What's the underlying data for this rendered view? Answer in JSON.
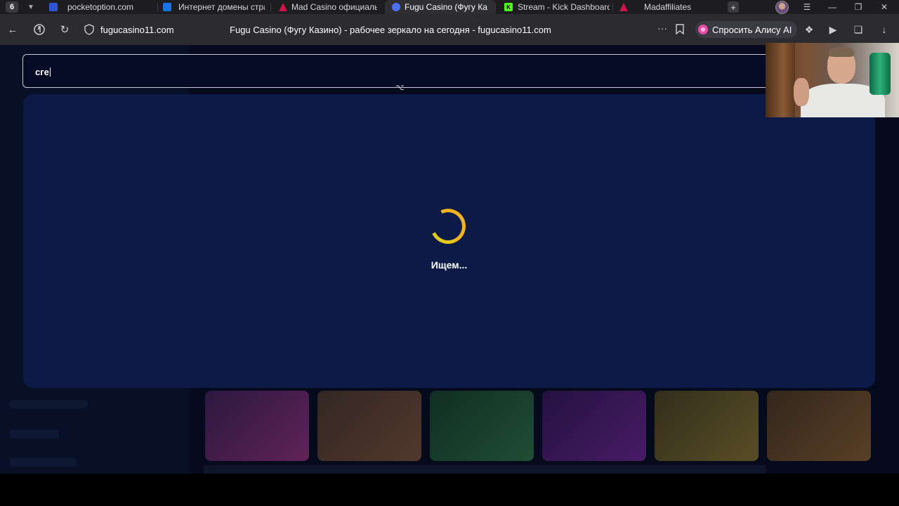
{
  "browser": {
    "tab_count": "6",
    "tabs": [
      {
        "title": "pocketoption.com",
        "favicon_color": "#2f55d4",
        "active": false
      },
      {
        "title": "Интернет домены стран",
        "favicon_color": "#1a73e8",
        "active": false
      },
      {
        "title": "Mad Casino официальны",
        "favicon_color": "#d0134a",
        "active": false
      },
      {
        "title": "Fugu Casino (Фугу Ка",
        "favicon_color": "#4a72ff",
        "active": true
      },
      {
        "title": "Stream - Kick Dashboard",
        "favicon_color": "#53fc18",
        "active": false
      },
      {
        "title": "Madaffiliates",
        "favicon_color": "#d0134a",
        "active": false
      }
    ],
    "tab_close_glyph": "✕",
    "new_tab_glyph": "+",
    "address": {
      "domain": "fugucasino11.com",
      "page_title": "Fugu Casino (Фугу Казино) - рабочее зеркало на сегодня - fugucasino11.com"
    },
    "alice_button_label": "Спросить Алису AI"
  },
  "page": {
    "search": {
      "value": "сге"
    },
    "loading": {
      "text": "Ищем..."
    },
    "colors": {
      "spinner": "#f4b31d",
      "panel": "#0c1a48",
      "background": "#050a1d"
    }
  }
}
